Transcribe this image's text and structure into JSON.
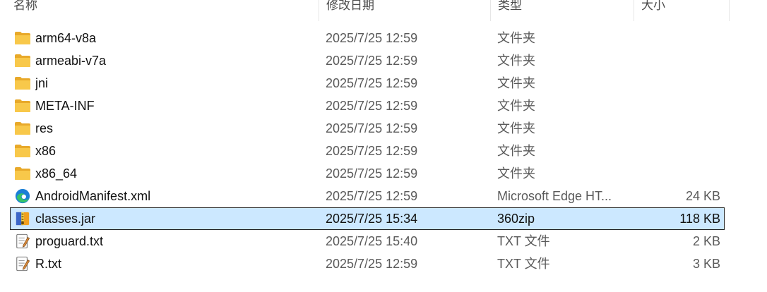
{
  "columns": {
    "name": "名称",
    "date": "修改日期",
    "type": "类型",
    "size": "大小"
  },
  "files": [
    {
      "name": "arm64-v8a",
      "date": "2025/7/25 12:59",
      "type": "文件夹",
      "size": "",
      "icon": "folder-icon"
    },
    {
      "name": "armeabi-v7a",
      "date": "2025/7/25 12:59",
      "type": "文件夹",
      "size": "",
      "icon": "folder-icon"
    },
    {
      "name": "jni",
      "date": "2025/7/25 12:59",
      "type": "文件夹",
      "size": "",
      "icon": "folder-icon"
    },
    {
      "name": "META-INF",
      "date": "2025/7/25 12:59",
      "type": "文件夹",
      "size": "",
      "icon": "folder-icon"
    },
    {
      "name": "res",
      "date": "2025/7/25 12:59",
      "type": "文件夹",
      "size": "",
      "icon": "folder-icon"
    },
    {
      "name": "x86",
      "date": "2025/7/25 12:59",
      "type": "文件夹",
      "size": "",
      "icon": "folder-icon"
    },
    {
      "name": "x86_64",
      "date": "2025/7/25 12:59",
      "type": "文件夹",
      "size": "",
      "icon": "folder-icon"
    },
    {
      "name": "AndroidManifest.xml",
      "date": "2025/7/25 12:59",
      "type": "Microsoft Edge HT...",
      "size": "24 KB",
      "icon": "edge-icon"
    },
    {
      "name": "classes.jar",
      "date": "2025/7/25 15:34",
      "type": "360zip",
      "size": "118 KB",
      "icon": "archive-icon",
      "selected": true
    },
    {
      "name": "proguard.txt",
      "date": "2025/7/25 15:40",
      "type": "TXT 文件",
      "size": "2 KB",
      "icon": "text-file-icon"
    },
    {
      "name": "R.txt",
      "date": "2025/7/25 12:59",
      "type": "TXT 文件",
      "size": "3 KB",
      "icon": "text-file-icon"
    }
  ],
  "colors": {
    "selection_bg": "#cce8ff",
    "folder": "#f8c84a",
    "edge_blue": "#1b7fd6",
    "edge_green": "#35c26a"
  }
}
